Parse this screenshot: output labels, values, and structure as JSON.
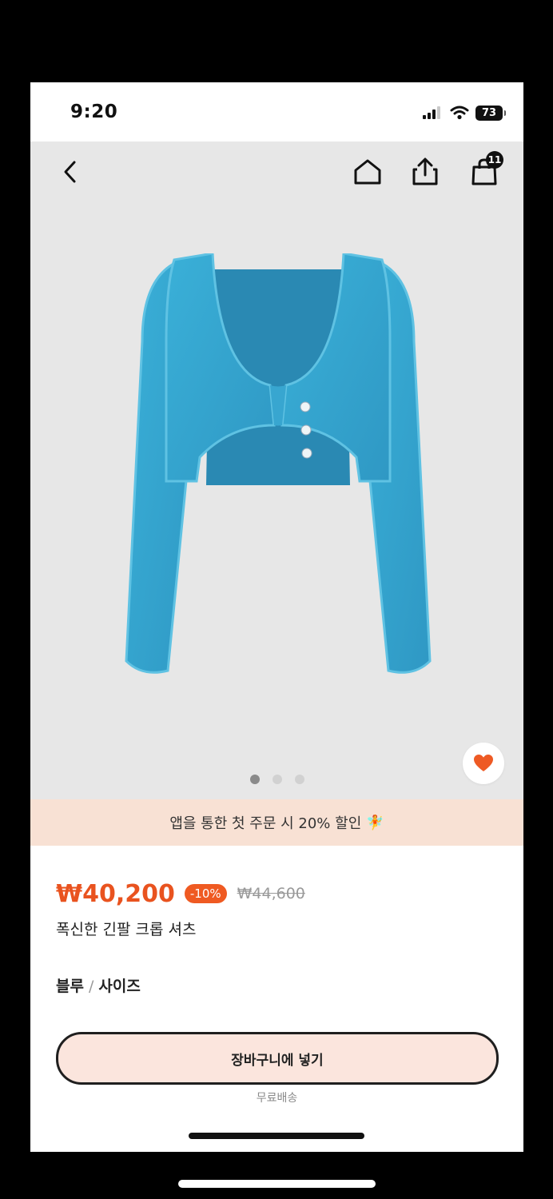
{
  "status_bar": {
    "time": "9:20",
    "battery": "73"
  },
  "header": {
    "cart_count": "11"
  },
  "colors": {
    "accent": "#e9531f",
    "promo_bg": "#f8e1d4",
    "sweater": "#35a2cc",
    "button_bg": "#fbe5dd"
  },
  "icons": {
    "back": "chevron-left-icon",
    "home": "home-icon",
    "share": "share-icon",
    "cart": "shopping-bag-icon",
    "wishlist": "heart-icon"
  },
  "carousel": {
    "total": 3,
    "active": 1
  },
  "promo": {
    "text": "앱을 통한 첫 주문 시 20% 할인",
    "emoji": "🧚"
  },
  "product": {
    "price": "₩40,200",
    "discount": "-10%",
    "original_price": "₩44,600",
    "name": "폭신한 긴팔 크롭 셔츠",
    "color_option": "블루",
    "separator": "/",
    "size_option": "사이즈"
  },
  "actions": {
    "add_to_cart": "장바구니에 넣기",
    "shipping_note": "무료배송"
  }
}
